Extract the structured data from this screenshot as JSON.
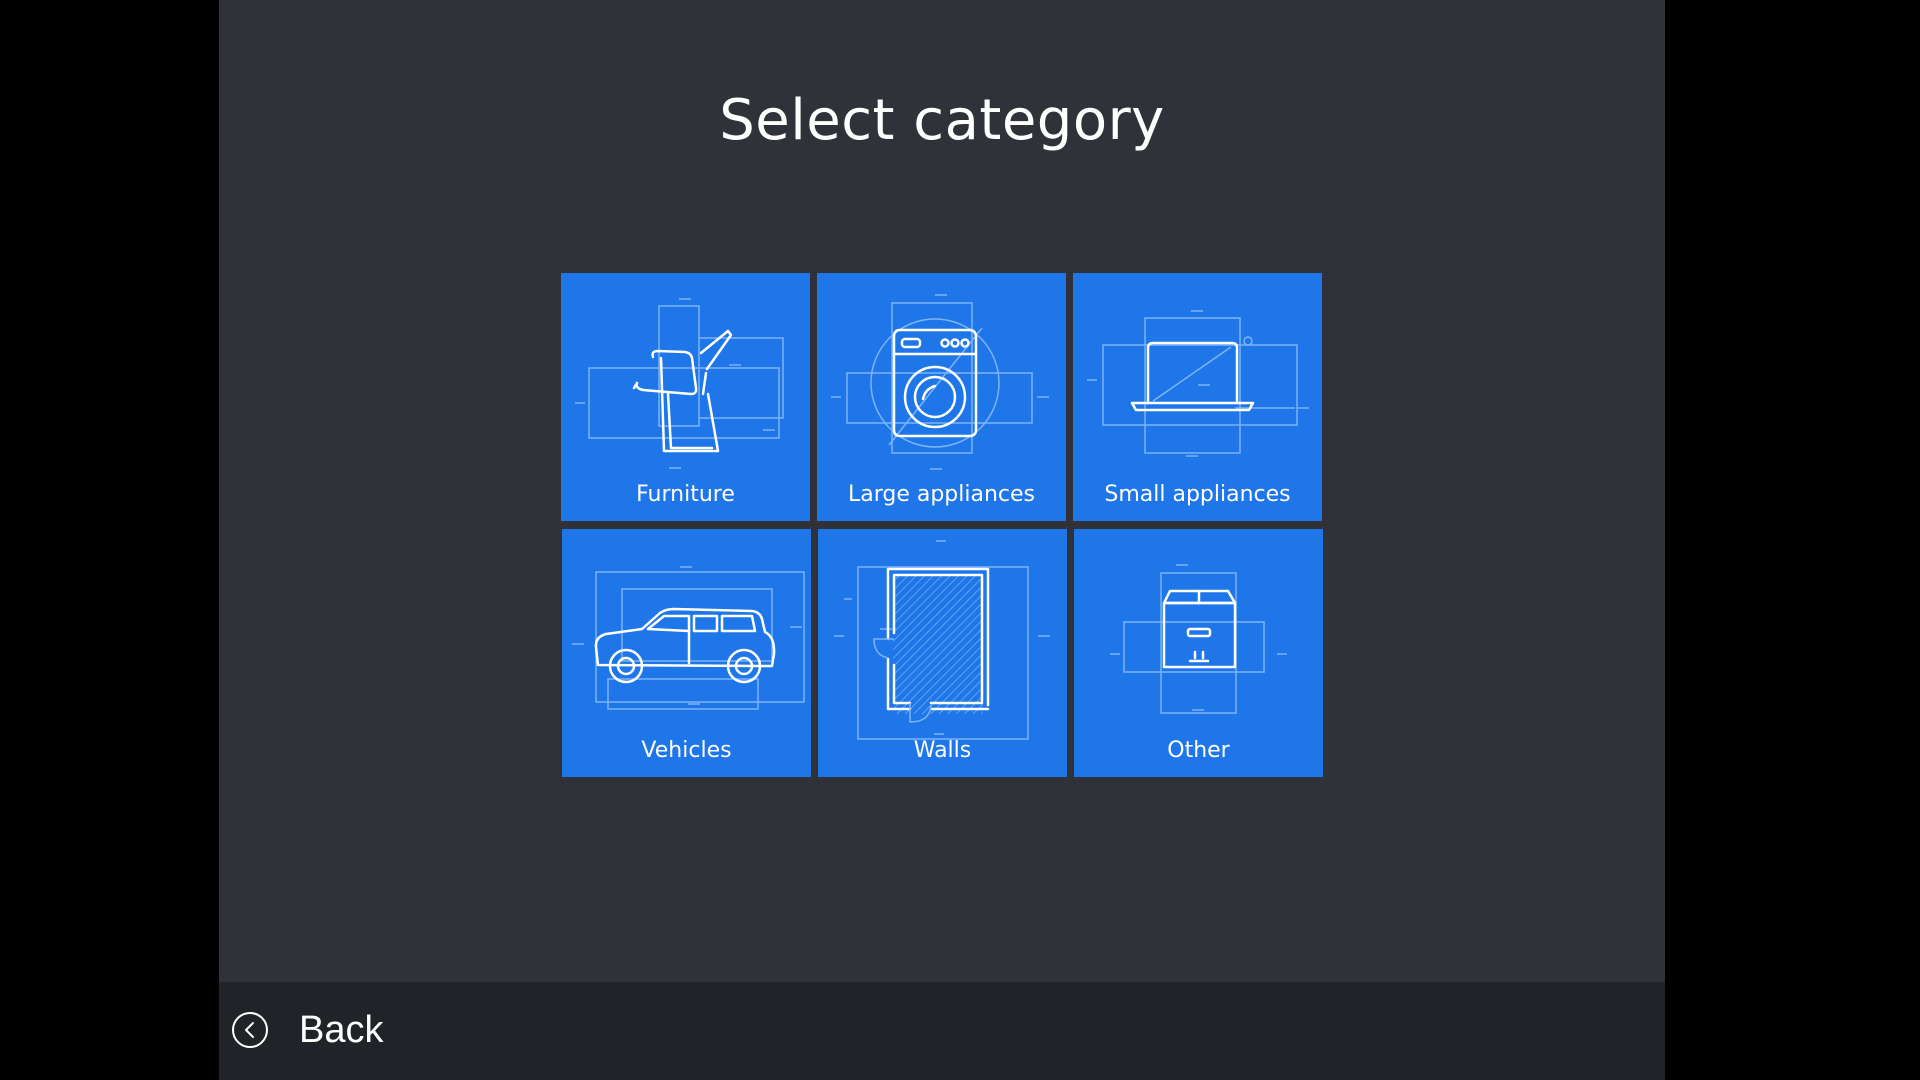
{
  "page": {
    "title": "Select category"
  },
  "tiles": [
    {
      "label": "Furniture",
      "icon": "chair-icon"
    },
    {
      "label": "Large appliances",
      "icon": "washing-machine-icon"
    },
    {
      "label": "Small appliances",
      "icon": "laptop-icon"
    },
    {
      "label": "Vehicles",
      "icon": "car-icon"
    },
    {
      "label": "Walls",
      "icon": "floor-plan-icon"
    },
    {
      "label": "Other",
      "icon": "box-icon"
    }
  ],
  "footer": {
    "back_label": "Back",
    "back_icon": "chevron-left-circle-icon"
  },
  "colors": {
    "background": "#2f3238",
    "tile": "#1e76e8",
    "footer": "#202327",
    "text": "#ffffff"
  }
}
